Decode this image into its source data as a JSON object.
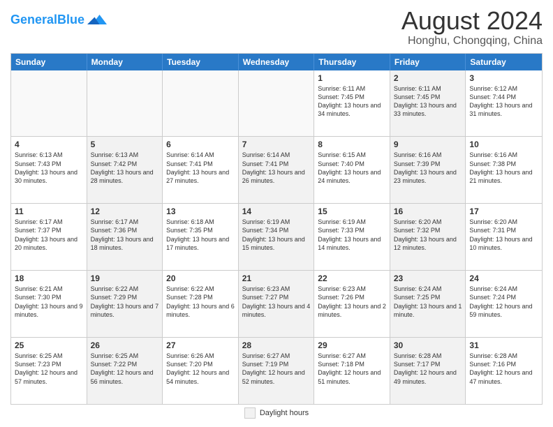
{
  "header": {
    "logo_general": "General",
    "logo_blue": "Blue",
    "month_year": "August 2024",
    "location": "Honghu, Chongqing, China"
  },
  "days_of_week": [
    "Sunday",
    "Monday",
    "Tuesday",
    "Wednesday",
    "Thursday",
    "Friday",
    "Saturday"
  ],
  "legend": {
    "label": "Daylight hours"
  },
  "weeks": [
    [
      {
        "day": "",
        "empty": true
      },
      {
        "day": "",
        "empty": true
      },
      {
        "day": "",
        "empty": true
      },
      {
        "day": "",
        "empty": true
      },
      {
        "day": "1",
        "shaded": false,
        "info": "Sunrise: 6:11 AM\nSunset: 7:45 PM\nDaylight: 13 hours\nand 34 minutes."
      },
      {
        "day": "2",
        "shaded": true,
        "info": "Sunrise: 6:11 AM\nSunset: 7:45 PM\nDaylight: 13 hours\nand 33 minutes."
      },
      {
        "day": "3",
        "shaded": false,
        "info": "Sunrise: 6:12 AM\nSunset: 7:44 PM\nDaylight: 13 hours\nand 31 minutes."
      }
    ],
    [
      {
        "day": "4",
        "shaded": false,
        "info": "Sunrise: 6:13 AM\nSunset: 7:43 PM\nDaylight: 13 hours\nand 30 minutes."
      },
      {
        "day": "5",
        "shaded": true,
        "info": "Sunrise: 6:13 AM\nSunset: 7:42 PM\nDaylight: 13 hours\nand 28 minutes."
      },
      {
        "day": "6",
        "shaded": false,
        "info": "Sunrise: 6:14 AM\nSunset: 7:41 PM\nDaylight: 13 hours\nand 27 minutes."
      },
      {
        "day": "7",
        "shaded": true,
        "info": "Sunrise: 6:14 AM\nSunset: 7:41 PM\nDaylight: 13 hours\nand 26 minutes."
      },
      {
        "day": "8",
        "shaded": false,
        "info": "Sunrise: 6:15 AM\nSunset: 7:40 PM\nDaylight: 13 hours\nand 24 minutes."
      },
      {
        "day": "9",
        "shaded": true,
        "info": "Sunrise: 6:16 AM\nSunset: 7:39 PM\nDaylight: 13 hours\nand 23 minutes."
      },
      {
        "day": "10",
        "shaded": false,
        "info": "Sunrise: 6:16 AM\nSunset: 7:38 PM\nDaylight: 13 hours\nand 21 minutes."
      }
    ],
    [
      {
        "day": "11",
        "shaded": false,
        "info": "Sunrise: 6:17 AM\nSunset: 7:37 PM\nDaylight: 13 hours\nand 20 minutes."
      },
      {
        "day": "12",
        "shaded": true,
        "info": "Sunrise: 6:17 AM\nSunset: 7:36 PM\nDaylight: 13 hours\nand 18 minutes."
      },
      {
        "day": "13",
        "shaded": false,
        "info": "Sunrise: 6:18 AM\nSunset: 7:35 PM\nDaylight: 13 hours\nand 17 minutes."
      },
      {
        "day": "14",
        "shaded": true,
        "info": "Sunrise: 6:19 AM\nSunset: 7:34 PM\nDaylight: 13 hours\nand 15 minutes."
      },
      {
        "day": "15",
        "shaded": false,
        "info": "Sunrise: 6:19 AM\nSunset: 7:33 PM\nDaylight: 13 hours\nand 14 minutes."
      },
      {
        "day": "16",
        "shaded": true,
        "info": "Sunrise: 6:20 AM\nSunset: 7:32 PM\nDaylight: 13 hours\nand 12 minutes."
      },
      {
        "day": "17",
        "shaded": false,
        "info": "Sunrise: 6:20 AM\nSunset: 7:31 PM\nDaylight: 13 hours\nand 10 minutes."
      }
    ],
    [
      {
        "day": "18",
        "shaded": false,
        "info": "Sunrise: 6:21 AM\nSunset: 7:30 PM\nDaylight: 13 hours\nand 9 minutes."
      },
      {
        "day": "19",
        "shaded": true,
        "info": "Sunrise: 6:22 AM\nSunset: 7:29 PM\nDaylight: 13 hours\nand 7 minutes."
      },
      {
        "day": "20",
        "shaded": false,
        "info": "Sunrise: 6:22 AM\nSunset: 7:28 PM\nDaylight: 13 hours\nand 6 minutes."
      },
      {
        "day": "21",
        "shaded": true,
        "info": "Sunrise: 6:23 AM\nSunset: 7:27 PM\nDaylight: 13 hours\nand 4 minutes."
      },
      {
        "day": "22",
        "shaded": false,
        "info": "Sunrise: 6:23 AM\nSunset: 7:26 PM\nDaylight: 13 hours\nand 2 minutes."
      },
      {
        "day": "23",
        "shaded": true,
        "info": "Sunrise: 6:24 AM\nSunset: 7:25 PM\nDaylight: 13 hours\nand 1 minute."
      },
      {
        "day": "24",
        "shaded": false,
        "info": "Sunrise: 6:24 AM\nSunset: 7:24 PM\nDaylight: 12 hours\nand 59 minutes."
      }
    ],
    [
      {
        "day": "25",
        "shaded": false,
        "info": "Sunrise: 6:25 AM\nSunset: 7:23 PM\nDaylight: 12 hours\nand 57 minutes."
      },
      {
        "day": "26",
        "shaded": true,
        "info": "Sunrise: 6:25 AM\nSunset: 7:22 PM\nDaylight: 12 hours\nand 56 minutes."
      },
      {
        "day": "27",
        "shaded": false,
        "info": "Sunrise: 6:26 AM\nSunset: 7:20 PM\nDaylight: 12 hours\nand 54 minutes."
      },
      {
        "day": "28",
        "shaded": true,
        "info": "Sunrise: 6:27 AM\nSunset: 7:19 PM\nDaylight: 12 hours\nand 52 minutes."
      },
      {
        "day": "29",
        "shaded": false,
        "info": "Sunrise: 6:27 AM\nSunset: 7:18 PM\nDaylight: 12 hours\nand 51 minutes."
      },
      {
        "day": "30",
        "shaded": true,
        "info": "Sunrise: 6:28 AM\nSunset: 7:17 PM\nDaylight: 12 hours\nand 49 minutes."
      },
      {
        "day": "31",
        "shaded": false,
        "info": "Sunrise: 6:28 AM\nSunset: 7:16 PM\nDaylight: 12 hours\nand 47 minutes."
      }
    ]
  ]
}
